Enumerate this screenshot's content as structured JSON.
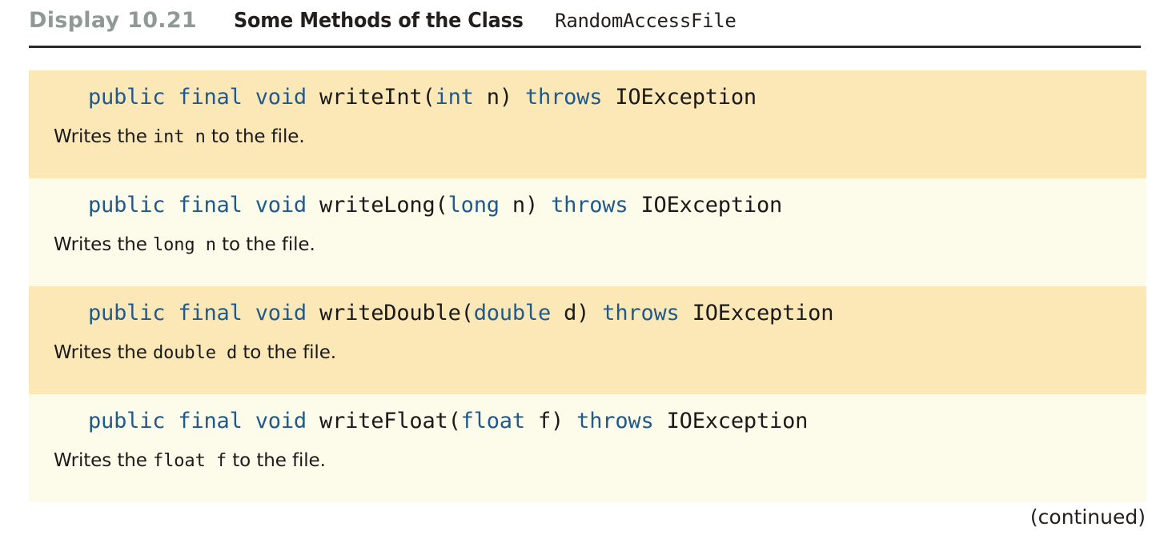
{
  "header": {
    "display_label": "Display 10.21",
    "title_prose": "Some Methods of the Class",
    "title_code": "RandomAccessFile"
  },
  "colors": {
    "row_shade_dark": "#fce8b7",
    "row_shade_light": "#fdfbe9",
    "keyword_blue": "#1f5a8c",
    "text_black": "#1a1a1a",
    "display_label_gray": "#8f9a95",
    "rule_dark": "#2b2b28",
    "page_background": "#ffffff"
  },
  "methods": [
    {
      "shade": "dark",
      "signature": {
        "modifiers": "public final void",
        "name": "writeInt",
        "open_paren": "(",
        "param_type": "int",
        "param_name": " n",
        "close_paren": ")",
        "throws_keyword": "throws",
        "exception": "IOException"
      },
      "description": {
        "lead": "Writes the ",
        "code": "int n",
        "tail": " to the file."
      }
    },
    {
      "shade": "light",
      "signature": {
        "modifiers": "public final void",
        "name": "writeLong",
        "open_paren": "(",
        "param_type": "long",
        "param_name": " n",
        "close_paren": ")",
        "throws_keyword": "throws",
        "exception": "IOException"
      },
      "description": {
        "lead": "Writes the ",
        "code": "long n",
        "tail": " to the file."
      }
    },
    {
      "shade": "dark",
      "signature": {
        "modifiers": "public final void",
        "name": "writeDouble",
        "open_paren": "(",
        "param_type": "double",
        "param_name": " d",
        "close_paren": ")",
        "throws_keyword": "throws",
        "exception": "IOException"
      },
      "description": {
        "lead": "Writes the ",
        "code": "double d",
        "tail": " to the file."
      }
    },
    {
      "shade": "light",
      "signature": {
        "modifiers": "public final void",
        "name": "writeFloat",
        "open_paren": "(",
        "param_type": "float",
        "param_name": " f",
        "close_paren": ")",
        "throws_keyword": "throws",
        "exception": "IOException"
      },
      "description": {
        "lead": "Writes the ",
        "code": "float f",
        "tail": " to the file."
      }
    }
  ],
  "footer": {
    "continued_label": "(continued)"
  }
}
